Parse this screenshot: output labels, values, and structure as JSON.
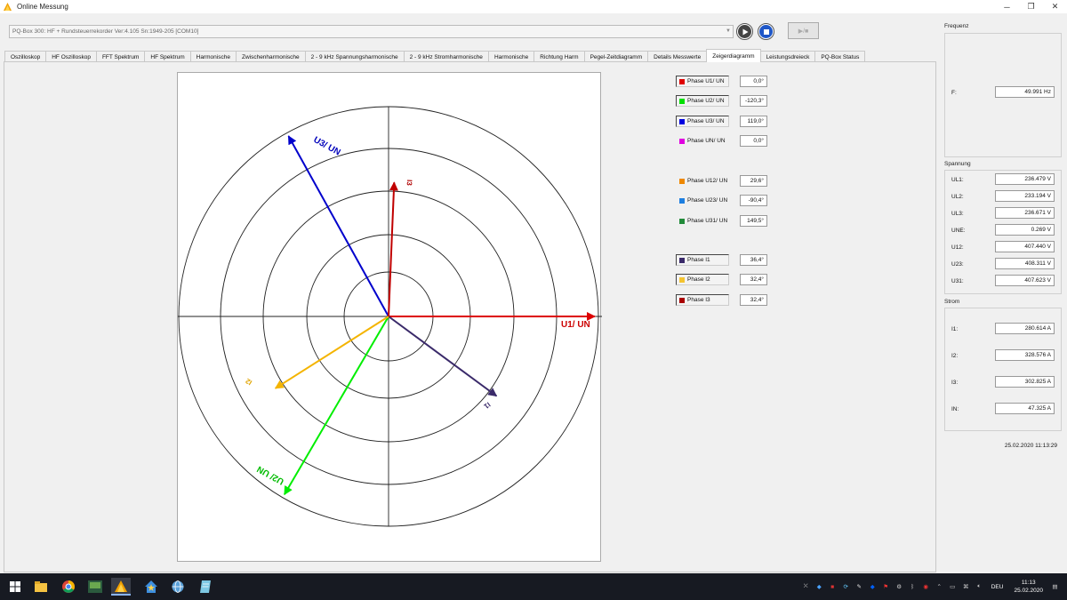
{
  "window": {
    "title": "Online Messung"
  },
  "device": {
    "selected": "PQ-Box 300: HF + Rundsteuerrekorder Ver:4.105 Sn:1949-205 [COM10]"
  },
  "toolbar": {
    "record_label": "▶/■"
  },
  "tabs": [
    {
      "label": "Oszilloskop"
    },
    {
      "label": "HF Oszilloskop"
    },
    {
      "label": "FFT Spektrum"
    },
    {
      "label": "HF Spektrum"
    },
    {
      "label": "Harmonische"
    },
    {
      "label": "Zwischenharmonische"
    },
    {
      "label": "2 - 9 kHz Spannungsharmonische"
    },
    {
      "label": "2 - 9 kHz Stromharmonische"
    },
    {
      "label": "Harmonische"
    },
    {
      "label": "Richtung Harm"
    },
    {
      "label": "Pegel-Zeitdiagramm"
    },
    {
      "label": "Details Messwerte"
    },
    {
      "label": "Zeigerdiagramm",
      "active": true
    },
    {
      "label": "Leistungsdreieck"
    },
    {
      "label": "PQ-Box Status"
    }
  ],
  "phasor_labels": {
    "u1": "U1/ UN",
    "u2": "U2/ UN",
    "u3": "U3/ UN",
    "i1": "I1",
    "i2": "I2",
    "i3": "I3"
  },
  "phasors": [
    {
      "name": "U1",
      "angle_deg": 0,
      "magnitude": 1.0,
      "color": "#dd0000"
    },
    {
      "name": "U2",
      "angle_deg": -120.3,
      "magnitude": 1.0,
      "color": "#00ee00"
    },
    {
      "name": "U3",
      "angle_deg": 119.0,
      "magnitude": 1.0,
      "color": "#0000cc"
    },
    {
      "name": "I1",
      "angle_deg": -36.4,
      "magnitude": 0.65,
      "color": "#3a2a6a"
    },
    {
      "name": "I2",
      "angle_deg": -147.6,
      "magnitude": 0.65,
      "color": "#f4b400"
    },
    {
      "name": "I3",
      "angle_deg": 87.6,
      "magnitude": 0.65,
      "color": "#c00000"
    }
  ],
  "legend": [
    {
      "label": "Phase U1/ UN",
      "value": "0,0°",
      "color": "#e00000"
    },
    {
      "label": "Phase U2/ UN",
      "value": "-120,3°",
      "color": "#00e000"
    },
    {
      "label": "Phase U3/ UN",
      "value": "119,0°",
      "color": "#0000e0"
    },
    {
      "label": "Phase UN/ UN",
      "value": "0,0°",
      "color": "#e000e0"
    },
    {
      "label": "Phase U12/ UN",
      "value": "29,6°",
      "color": "#ee8800"
    },
    {
      "label": "Phase U23/ UN",
      "value": "-90,4°",
      "color": "#1e7fe0"
    },
    {
      "label": "Phase U31/ UN",
      "value": "149,5°",
      "color": "#228b3a"
    },
    {
      "label": "Phase I1",
      "value": "36,4°",
      "color": "#3a2a6a"
    },
    {
      "label": "Phase I2",
      "value": "32,4°",
      "color": "#f4c430"
    },
    {
      "label": "Phase I3",
      "value": "32,4°",
      "color": "#aa0000"
    }
  ],
  "frequenz": {
    "title": "Frequenz",
    "label": "F:",
    "value": "49.991 Hz"
  },
  "spannung": {
    "title": "Spannung",
    "rows": [
      {
        "label": "UL1:",
        "value": "236.479 V"
      },
      {
        "label": "UL2:",
        "value": "233.194 V"
      },
      {
        "label": "UL3:",
        "value": "236.671 V"
      },
      {
        "label": "UNE:",
        "value": "0.269 V"
      },
      {
        "label": "U12:",
        "value": "407.440 V"
      },
      {
        "label": "U23:",
        "value": "408.311 V"
      },
      {
        "label": "U31:",
        "value": "407.623 V"
      }
    ]
  },
  "strom": {
    "title": "Strom",
    "rows": [
      {
        "label": "I1:",
        "value": "280.614 A"
      },
      {
        "label": "I2:",
        "value": "328.576 A"
      },
      {
        "label": "I3:",
        "value": "302.825 A"
      },
      {
        "label": "IN:",
        "value": "47.325 A"
      }
    ]
  },
  "timestamp": "25.02.2020 11:13:29",
  "taskbar": {
    "language": "DEU",
    "time": "11:13",
    "date": "25.02.2020"
  }
}
